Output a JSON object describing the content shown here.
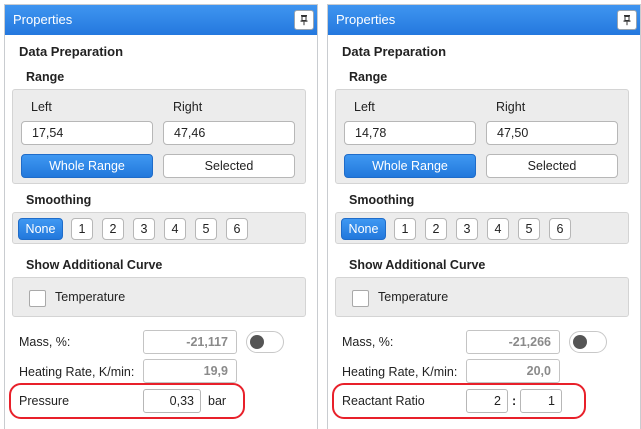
{
  "panels": [
    {
      "header_title": "Properties",
      "section_title": "Data Preparation",
      "range": {
        "title": "Range",
        "left_label": "Left",
        "right_label": "Right",
        "left_value": "17,54",
        "right_value": "47,46",
        "whole_range_label": "Whole Range",
        "selected_label": "Selected"
      },
      "smoothing": {
        "title": "Smoothing",
        "options": [
          "None",
          "1",
          "2",
          "3",
          "4",
          "5",
          "6"
        ],
        "active": "None"
      },
      "additional_curve": {
        "title": "Show Additional Curve",
        "checkbox_label": "Temperature",
        "checked": false
      },
      "mass": {
        "label": "Mass, %:",
        "value": "-21,117",
        "toggle_on": false
      },
      "heating_rate": {
        "label": "Heating Rate, K/min:",
        "value": "19,9"
      },
      "pressure": {
        "label": "Pressure",
        "value": "0,33",
        "unit": "bar"
      }
    },
    {
      "header_title": "Properties",
      "section_title": "Data Preparation",
      "range": {
        "title": "Range",
        "left_label": "Left",
        "right_label": "Right",
        "left_value": "14,78",
        "right_value": "47,50",
        "whole_range_label": "Whole Range",
        "selected_label": "Selected"
      },
      "smoothing": {
        "title": "Smoothing",
        "options": [
          "None",
          "1",
          "2",
          "3",
          "4",
          "5",
          "6"
        ],
        "active": "None"
      },
      "additional_curve": {
        "title": "Show Additional Curve",
        "checkbox_label": "Temperature",
        "checked": false
      },
      "mass": {
        "label": "Mass, %:",
        "value": "-21,266",
        "toggle_on": false
      },
      "heating_rate": {
        "label": "Heating Rate, K/min:",
        "value": "20,0"
      },
      "reactant_ratio": {
        "label": "Reactant Ratio",
        "value_a": "2",
        "separator": ":",
        "value_b": "1"
      }
    }
  ],
  "colors": {
    "header_blue": "#2c84e6",
    "active_button": "#2f88e8",
    "highlight_red": "#e8202a",
    "panel_gray": "#ececec"
  },
  "icons": {
    "pin": "pin-icon"
  }
}
